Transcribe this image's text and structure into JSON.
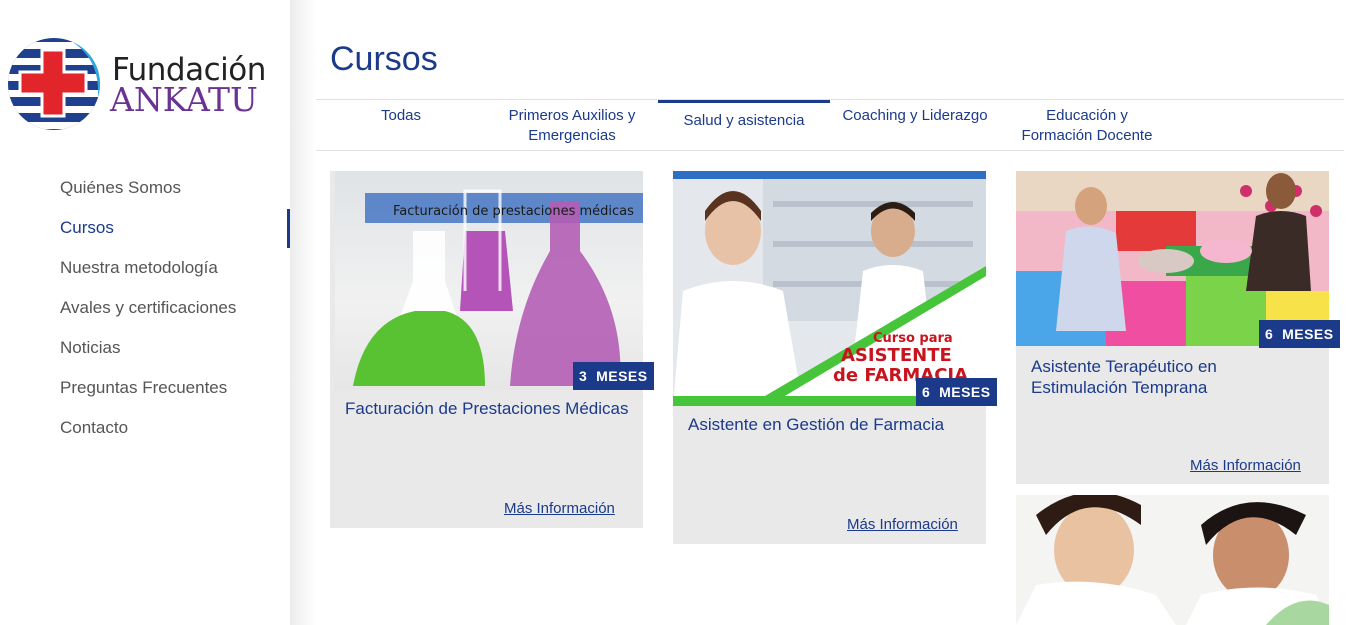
{
  "logo": {
    "line1": "Fundación",
    "line2": "ANKATU"
  },
  "nav": [
    {
      "label": "Quiénes Somos"
    },
    {
      "label": "Cursos"
    },
    {
      "label": "Nuestra metodología"
    },
    {
      "label": "Avales y certificaciones"
    },
    {
      "label": "Noticias"
    },
    {
      "label": "Preguntas Frecuentes"
    },
    {
      "label": "Contacto"
    }
  ],
  "nav_active": "Cursos",
  "page_title": "Cursos",
  "tabs": [
    {
      "label": "Todas"
    },
    {
      "label": "Primeros Auxilios y Emergencias"
    },
    {
      "label": "Salud y asistencia"
    },
    {
      "label": "Coaching y Liderazgo"
    },
    {
      "label": "Educación y Formación Docente"
    }
  ],
  "tab_active": "Salud y asistencia",
  "cards": [
    {
      "image_caption": "Facturación de prestaciones médicas",
      "badge": "3  MESES",
      "title": "Facturación de Prestaciones Médicas",
      "link": "Más Información"
    },
    {
      "image_caption_1": "Curso para",
      "image_caption_2": "ASISTENTE",
      "image_caption_3": "de FARMACIA",
      "badge": "6  MESES",
      "title": "Asistente en Gestión de Farmacia",
      "link": "Más Información"
    },
    {
      "badge": "6  MESES",
      "title": "Asistente Terapéutico en Estimulación Temprana",
      "link": "Más Información"
    }
  ],
  "colors": {
    "brand_blue": "#1b3a8a",
    "brand_purple": "#6b3391",
    "logo_red": "#e2242b",
    "card_bg": "#e9e9ea"
  }
}
